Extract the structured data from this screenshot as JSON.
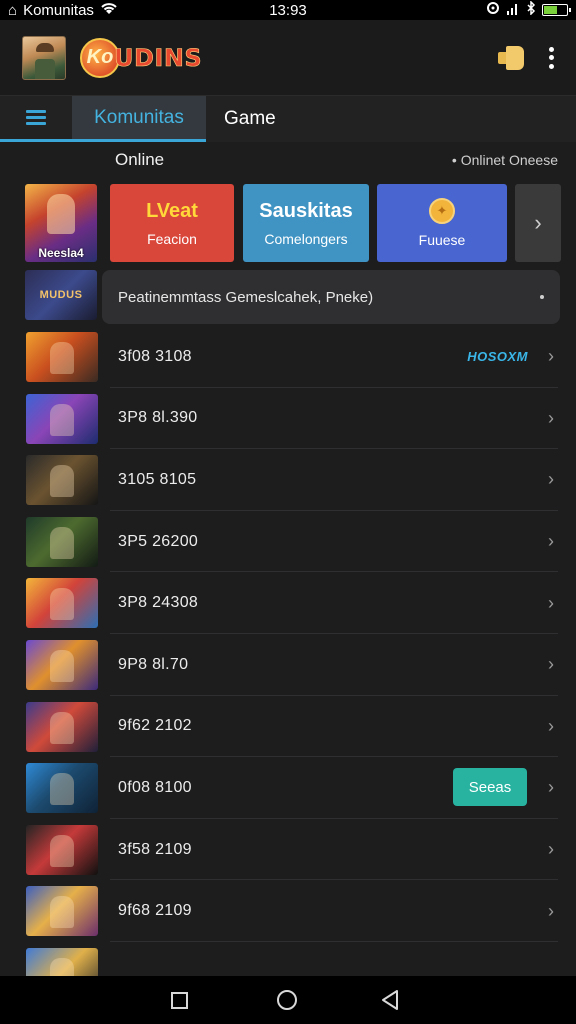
{
  "status_bar": {
    "app_name": "Komunitas",
    "time": "13:93"
  },
  "app_bar": {
    "logo_badge": "Ko",
    "logo_text": "UDINS"
  },
  "tabs": [
    {
      "label": "Komunitas",
      "active": true
    },
    {
      "label": "Game",
      "active": false
    }
  ],
  "online": {
    "label": "Online",
    "right_text": "• Onlinet Oneese"
  },
  "featured": {
    "thumb_caption": "Neesla4",
    "cards": [
      {
        "title": "LVeat",
        "subtitle": "Feacion",
        "color": "#d9463a"
      },
      {
        "title": "Sauskitas",
        "subtitle": "Comelongers",
        "color": "#3f94c4"
      },
      {
        "title": "",
        "subtitle": "Fuuese",
        "color": "#4865d0",
        "icon": "badge-icon"
      }
    ],
    "more_icon": "chevron-right-icon"
  },
  "promo": {
    "thumb_caption": "MUDUS",
    "text": "Peatinemmtass Gemeslcahek, Pneke)"
  },
  "list": [
    {
      "label": "3f08 3108",
      "tag_text": "HOSOXM",
      "tag_color": "#3ab6e8"
    },
    {
      "label": "3P8 8l.390"
    },
    {
      "label": "3105 8105"
    },
    {
      "label": "3P5 26200"
    },
    {
      "label": "3P8 24308"
    },
    {
      "label": "9P8 8l.70"
    },
    {
      "label": "9f62 2102"
    },
    {
      "label": "0f08 8100",
      "button_label": "Seeas",
      "button_color": "#27b3a0"
    },
    {
      "label": "3f58 2109"
    },
    {
      "label": "9f68 2109"
    },
    {
      "label": ""
    }
  ],
  "nav_bar": {
    "icons": [
      "recents-icon",
      "home-icon",
      "back-icon"
    ]
  }
}
